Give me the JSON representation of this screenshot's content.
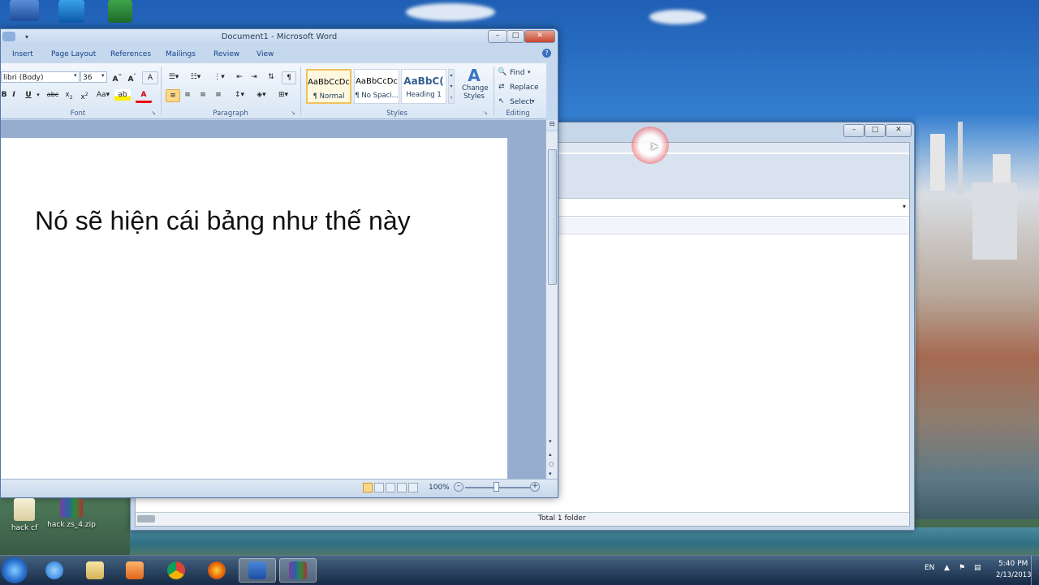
{
  "word": {
    "title": "Document1 - Microsoft Word",
    "tabs": [
      "Insert",
      "Page Layout",
      "References",
      "Mailings",
      "Review",
      "View"
    ],
    "font": {
      "name": "libri (Body)",
      "size": "36"
    },
    "group_labels": {
      "font": "Font",
      "paragraph": "Paragraph",
      "styles": "Styles",
      "editing": "Editing"
    },
    "styles": [
      {
        "preview": "AaBbCcDc",
        "name": "¶ Normal"
      },
      {
        "preview": "AaBbCcDc",
        "name": "¶ No Spaci..."
      },
      {
        "preview": "AaBbC(",
        "name": "Heading 1"
      }
    ],
    "change_styles": "Change Styles",
    "editing": {
      "find": "Find",
      "replace": "Replace",
      "select": "Select"
    },
    "document_text": "Nó sẽ hiện cái bảng như thế này",
    "zoom": "100%"
  },
  "explorer": {
    "status_text": "Total 1 folder"
  },
  "desktop_icons": [
    {
      "label": "hack cf"
    },
    {
      "label": "hack zs_4.zip"
    }
  ],
  "tray": {
    "lang": "EN",
    "time": "5:40 PM",
    "date": "2/13/2013"
  },
  "icons": {
    "start": "windows-orb",
    "taskbar": [
      "internet-explorer",
      "file-explorer",
      "media-player",
      "chrome",
      "firefox",
      "word",
      "winrar"
    ]
  }
}
